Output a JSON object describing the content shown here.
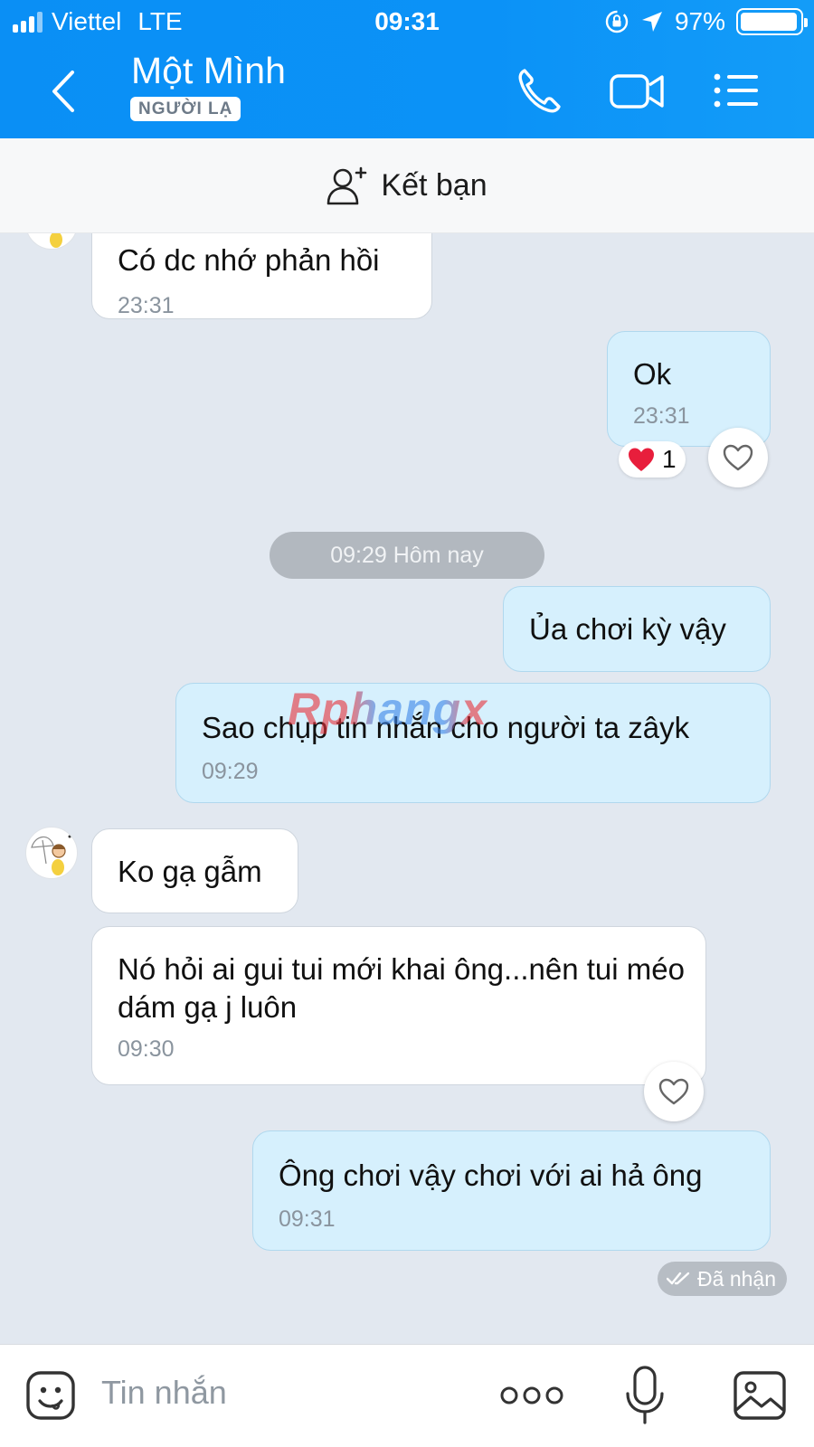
{
  "status_bar": {
    "carrier": "Viettel",
    "network": "LTE",
    "time": "09:31",
    "battery": "97%",
    "battery_level": 0.97
  },
  "header": {
    "contact_name": "Một Mình",
    "badge": "NGƯỜI LẠ",
    "icons": [
      "back-icon",
      "phone-icon",
      "video-call-icon",
      "menu-icon"
    ]
  },
  "friend_bar": {
    "label": "Kết bạn",
    "icon": "add-friend-icon"
  },
  "messages": [
    {
      "direction": "in",
      "text": "Có dc nhớ phản hồi",
      "time": "23:31"
    },
    {
      "direction": "out",
      "text": "Ok",
      "time": "23:31",
      "reaction": {
        "emoji": "❤",
        "count": "1"
      }
    },
    {
      "direction": "out",
      "text": "Ủa chơi kỳ vậy"
    },
    {
      "direction": "out",
      "text": "Sao chụp tin nhắn cho người ta zâyk",
      "time": "09:29"
    },
    {
      "direction": "in",
      "text": "Ko gạ gẫm"
    },
    {
      "direction": "in",
      "text": "Nó hỏi ai gui tui mới khai ông...nên tui méo dám gạ j luôn",
      "time": "09:30"
    },
    {
      "direction": "out",
      "text": "Ông chơi vậy chơi với ai hả ông",
      "time": "09:31"
    }
  ],
  "date_separator": "09:29 Hôm nay",
  "received_status": "Đã nhận",
  "watermark": "Rphangx",
  "input_bar": {
    "placeholder": "Tin nhắn",
    "icons": [
      "emoji-icon",
      "more-icon",
      "microphone-icon",
      "image-icon"
    ]
  }
}
